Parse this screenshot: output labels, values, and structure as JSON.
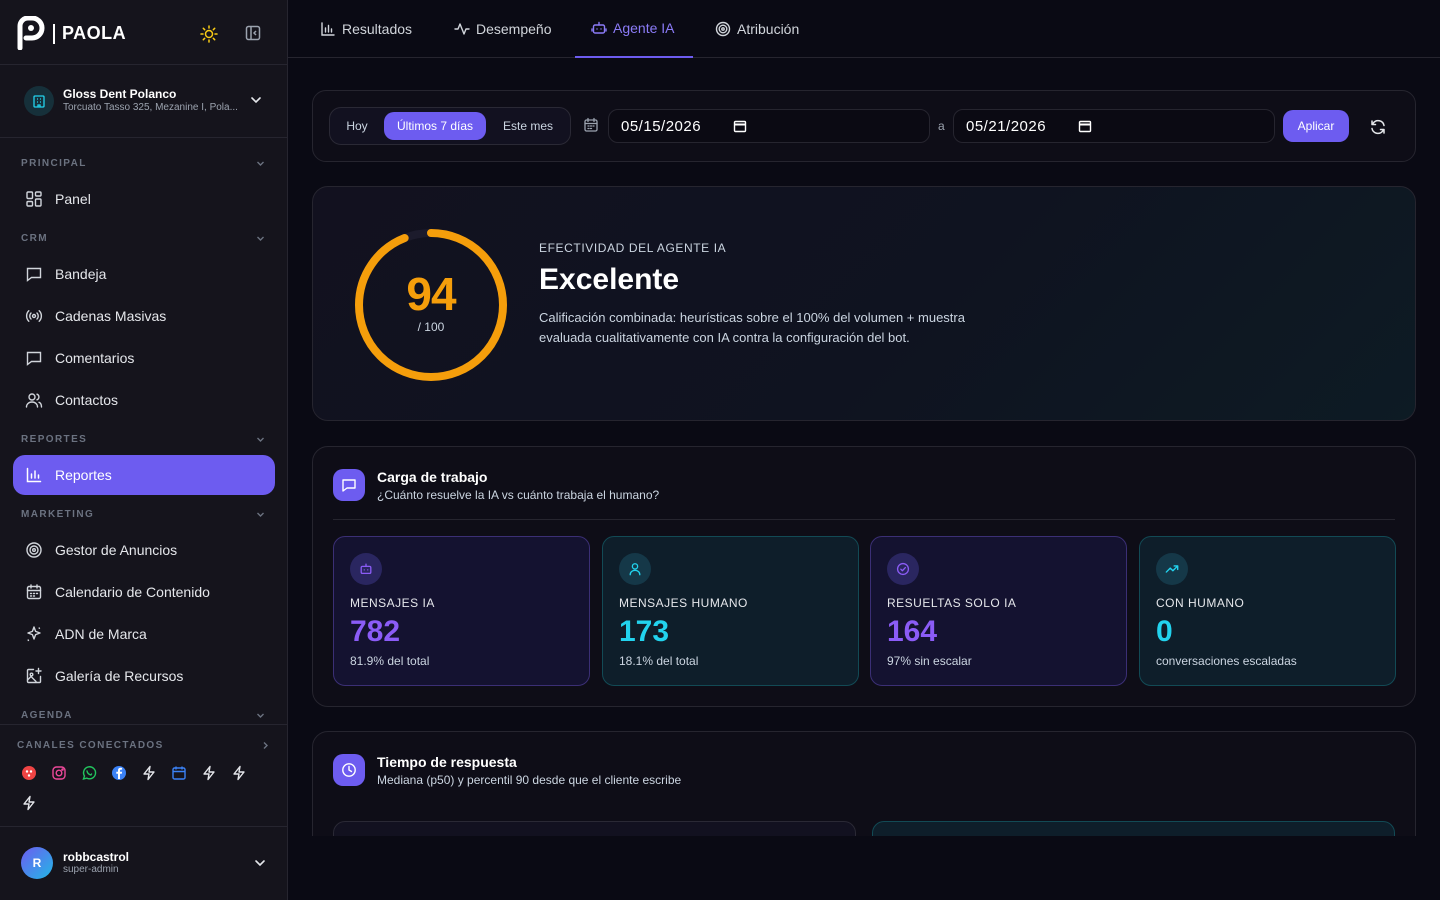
{
  "brand": {
    "name": "PAOLA"
  },
  "account": {
    "name": "Gloss Dent Polanco",
    "address": "Torcuato Tasso 325, Mezanine I, Pola..."
  },
  "nav": {
    "sections": {
      "principal": "PRINCIPAL",
      "crm": "CRM",
      "reportes": "REPORTES",
      "marketing": "MARKETING",
      "agenda": "AGENDA"
    },
    "items": {
      "panel": "Panel",
      "bandeja": "Bandeja",
      "cadenas": "Cadenas Masivas",
      "comentarios": "Comentarios",
      "contactos": "Contactos",
      "reportes": "Reportes",
      "gestor": "Gestor de Anuncios",
      "calendario": "Calendario de Contenido",
      "adn": "ADN de Marca",
      "galeria": "Galería de Recursos"
    }
  },
  "channels": {
    "title": "CANALES CONECTADOS"
  },
  "user": {
    "initial": "R",
    "name": "robbcastrol",
    "role": "super-admin"
  },
  "tabs": {
    "resultados": "Resultados",
    "desempeno": "Desempeño",
    "agente": "Agente IA",
    "atribucion": "Atribución"
  },
  "filter": {
    "range": {
      "hoy": "Hoy",
      "ultimos": "Últimos 7 días",
      "mes": "Este mes"
    },
    "date_from": "05/15/2026",
    "date_sep": "a",
    "date_to": "05/21/2026",
    "apply": "Aplicar"
  },
  "score": {
    "value": "94",
    "value_num": 94,
    "max": "/ 100",
    "kicker": "EFECTIVIDAD DEL AGENTE IA",
    "title": "Excelente",
    "description": "Calificación combinada: heurísticas sobre el 100% del volumen + muestra evaluada cualitativamente con IA contra la configuración del bot."
  },
  "workload": {
    "title": "Carga de trabajo",
    "subtitle": "¿Cuánto resuelve la IA vs cuánto trabaja el humano?",
    "stats": [
      {
        "label": "MENSAJES IA",
        "value": "782",
        "foot": "81.9% del total"
      },
      {
        "label": "MENSAJES HUMANO",
        "value": "173",
        "foot": "18.1% del total"
      },
      {
        "label": "RESUELTAS SOLO IA",
        "value": "164",
        "foot": "97% sin escalar"
      },
      {
        "label": "CON HUMANO",
        "value": "0",
        "foot": "conversaciones escaladas"
      }
    ]
  },
  "response": {
    "title": "Tiempo de respuesta",
    "subtitle": "Mediana (p50) y percentil 90 desde que el cliente escribe"
  },
  "colors": {
    "accent": "#6d5cf0",
    "gauge": "#f59e0b",
    "ia_value": "#8b5cf6",
    "human_value": "#22d3ee"
  }
}
